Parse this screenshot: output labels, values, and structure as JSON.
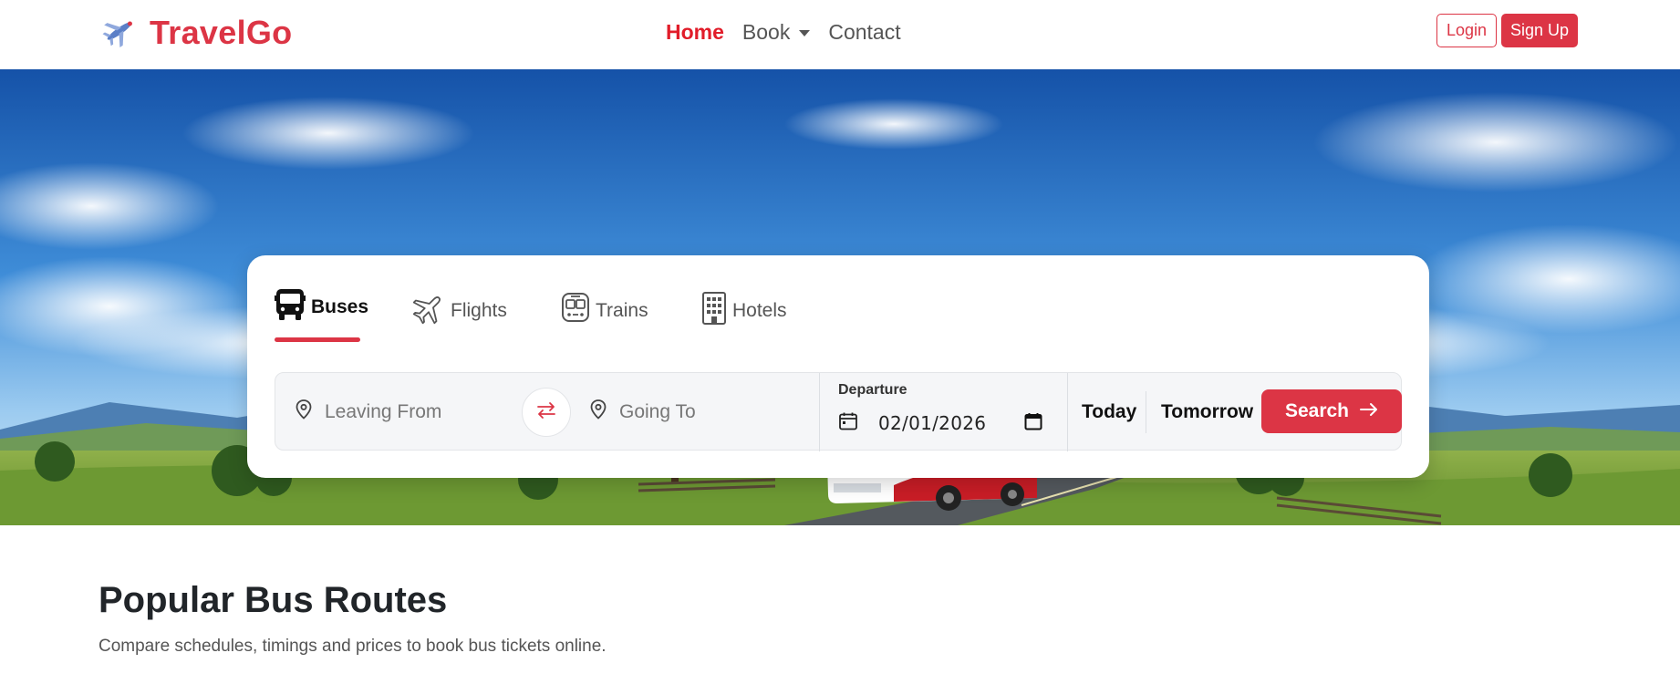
{
  "brand": {
    "name": "TravelGo",
    "icon": "airplane-icon",
    "color": "#dc3545"
  },
  "nav": {
    "links": [
      {
        "label": "Home",
        "active": true
      },
      {
        "label": "Book",
        "dropdown": true
      },
      {
        "label": "Contact"
      }
    ],
    "login_label": "Login",
    "signup_label": "Sign Up"
  },
  "search": {
    "tabs": [
      {
        "label": "Buses",
        "icon": "bus-icon",
        "active": true
      },
      {
        "label": "Flights",
        "icon": "airplane-icon"
      },
      {
        "label": "Trains",
        "icon": "train-icon"
      },
      {
        "label": "Hotels",
        "icon": "building-icon"
      }
    ],
    "from_placeholder": "Leaving From",
    "to_placeholder": "Going To",
    "departure_label": "Departure",
    "departure_value": "02/01/2026",
    "today_label": "Today",
    "tomorrow_label": "Tomorrow",
    "search_label": "Search"
  },
  "popular": {
    "title": "Popular Bus Routes",
    "subtitle": "Compare schedules, timings and prices to book bus tickets online."
  },
  "colors": {
    "accent": "#dc3545",
    "sky": "#1f6fc4",
    "grass": "#7fa43a"
  }
}
